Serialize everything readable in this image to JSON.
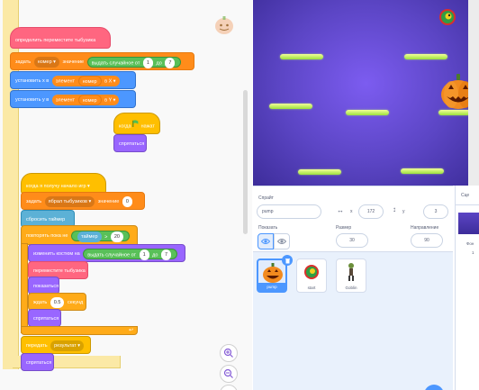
{
  "blocks": {
    "define": "определить  переместите тыбузика",
    "set_number_a": "задать",
    "set_number_var": "номер ▾",
    "set_number_b": "значение",
    "random_a": "выдать случайное от",
    "random_from": "1",
    "random_to_word": "до",
    "random_to": "7",
    "set_x_a": "установить x в",
    "set_x_item": "элемент",
    "set_x_index": "номер",
    "set_x_of": "в",
    "set_x_list": "X ▾",
    "set_y_a": "установить y в",
    "set_y_item": "элемент",
    "set_y_index": "номер",
    "set_y_of": "в",
    "set_y_list": "Y ▾",
    "when_flag_a": "когда",
    "when_flag_b": "нажат",
    "hide_1": "спрятаться",
    "when_receive": "когда я получу  начало игр ▾",
    "set_caught_a": "задать",
    "set_caught_var": "ябрал тыбузиков ▾",
    "set_caught_b": "значение",
    "set_caught_val": "0",
    "reset_timer": "сбросить таймер",
    "repeat_until": "повторять пока не",
    "timer": "таймер",
    "gt": ">",
    "timer_limit": "20",
    "change_costume": "изменить костюм на",
    "costume_random": "выдать случайное от",
    "costume_from": "1",
    "costume_to_word": "до",
    "costume_to": "7",
    "call_move": "переместите тыбузика",
    "show": "показаться",
    "wait_a": "ждать",
    "wait_val": "0.5",
    "wait_b": "секунд",
    "hide_2": "спрятаться",
    "broadcast_a": "передать",
    "broadcast_msg": "результат ▾",
    "hide_3": "спрятаться"
  },
  "sprite_info": {
    "sprite_label": "Спрайт",
    "sprite_name": "pump",
    "x_label": "x",
    "x_value": "172",
    "y_label": "y",
    "y_value": "3",
    "show_label": "Показать",
    "size_label": "Размер",
    "size_value": "30",
    "direction_label": "Направление",
    "direction_value": "90"
  },
  "sprites": [
    {
      "name": "pump",
      "selected": true
    },
    {
      "name": "start",
      "selected": false
    },
    {
      "name": "Goblin",
      "selected": false
    }
  ],
  "backdrop": {
    "header": "Сце",
    "label": "Фон",
    "count": "1"
  },
  "colors": {
    "events": "#ffbf00",
    "control": "#ffab19",
    "motion": "#4c97ff",
    "looks": "#9966ff",
    "variables": "#ff8c1a",
    "operators": "#59c059",
    "my_blocks": "#ff6680",
    "stage_bg": "#5b45c4",
    "platform": "#9be03c"
  }
}
